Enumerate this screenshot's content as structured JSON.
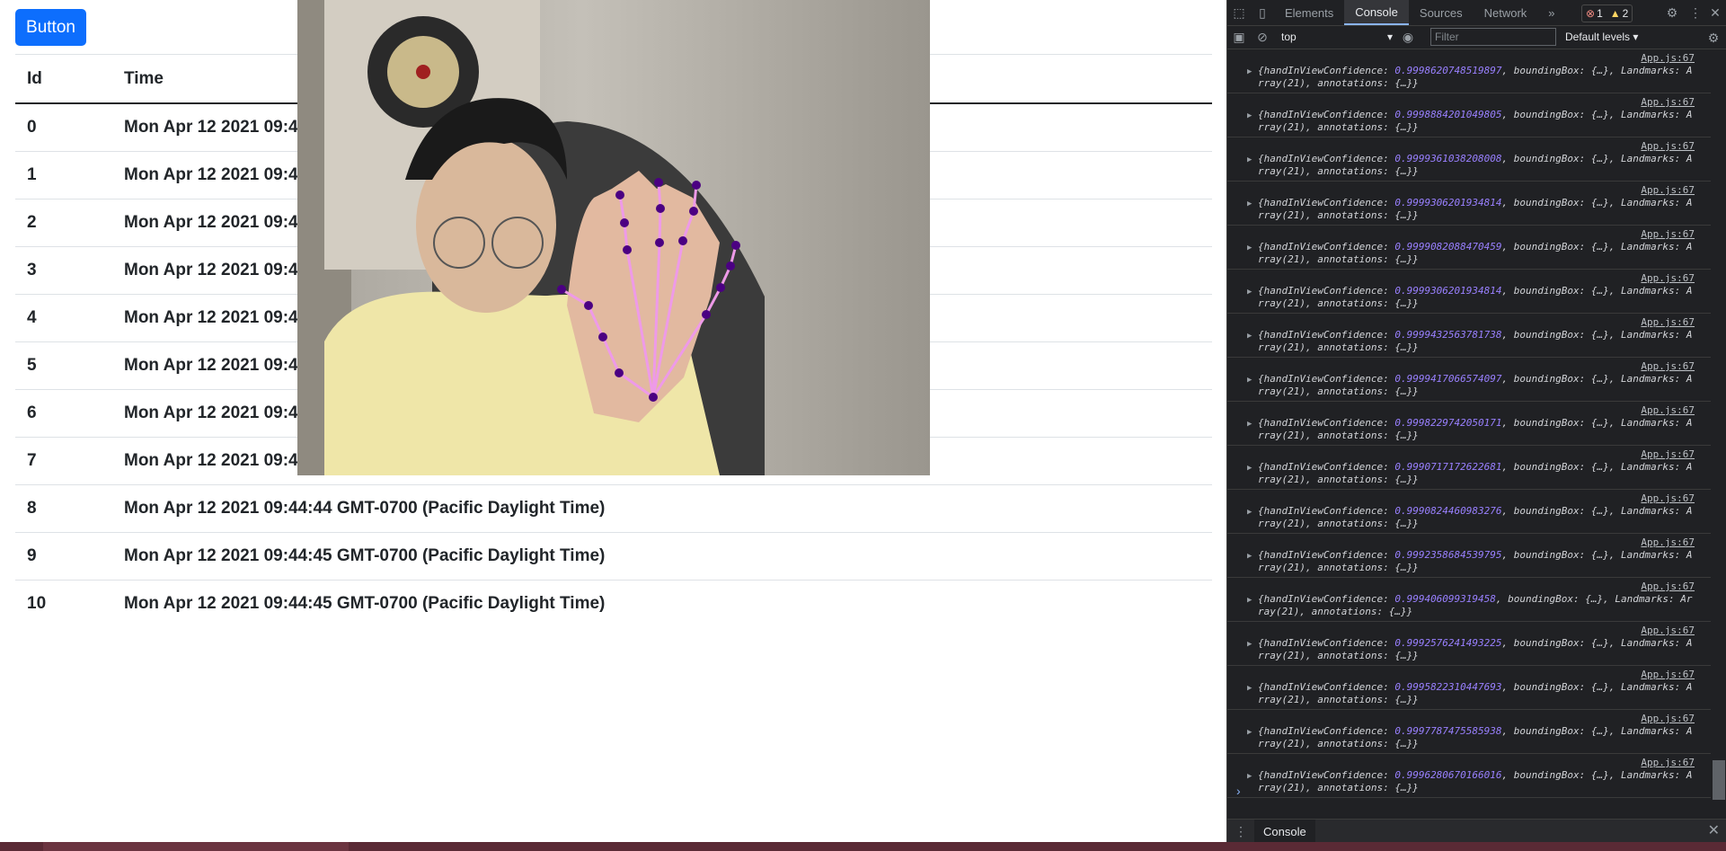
{
  "page": {
    "button_label": "Button",
    "table": {
      "headers": [
        "Id",
        "Time"
      ],
      "rows": [
        {
          "id": "0",
          "time": "Mon Apr 12 2021 09:44"
        },
        {
          "id": "1",
          "time": "Mon Apr 12 2021 09:44"
        },
        {
          "id": "2",
          "time": "Mon Apr 12 2021 09:44"
        },
        {
          "id": "3",
          "time": "Mon Apr 12 2021 09:44"
        },
        {
          "id": "4",
          "time": "Mon Apr 12 2021 09:44"
        },
        {
          "id": "5",
          "time": "Mon Apr 12 2021 09:44"
        },
        {
          "id": "6",
          "time": "Mon Apr 12 2021 09:44"
        },
        {
          "id": "7",
          "time": "Mon Apr 12 2021 09:44"
        },
        {
          "id": "8",
          "time": "Mon Apr 12 2021 09:44:44 GMT-0700 (Pacific Daylight Time)"
        },
        {
          "id": "9",
          "time": "Mon Apr 12 2021 09:44:45 GMT-0700 (Pacific Daylight Time)"
        },
        {
          "id": "10",
          "time": "Mon Apr 12 2021 09:44:45 GMT-0700 (Pacific Daylight Time)"
        }
      ]
    }
  },
  "devtools": {
    "tabs": [
      "Elements",
      "Console",
      "Sources",
      "Network"
    ],
    "active_tab": "Console",
    "more_tabs": "»",
    "error_count": "1",
    "warning_count": "2",
    "context": "top",
    "filter_placeholder": "Filter",
    "levels": "Default levels",
    "drawer_tab": "Console",
    "log_source": "App.js:67",
    "log_entries": [
      {
        "confidence": "0.9998620748519897",
        "l1_tail": ", boundingBox: {…}, Landmarks: A",
        "line2": "rray(21), annotations: {…}}"
      },
      {
        "confidence": "0.9998884201049805",
        "l1_tail": ", boundingBox: {…}, Landmarks: A",
        "line2": "rray(21), annotations: {…}}"
      },
      {
        "confidence": "0.9999361038208008",
        "l1_tail": ", boundingBox: {…}, Landmarks: A",
        "line2": "rray(21), annotations: {…}}"
      },
      {
        "confidence": "0.9999306201934814",
        "l1_tail": ", boundingBox: {…}, Landmarks: A",
        "line2": "rray(21), annotations: {…}}"
      },
      {
        "confidence": "0.9999082088470459",
        "l1_tail": ", boundingBox: {…}, Landmarks: A",
        "line2": "rray(21), annotations: {…}}"
      },
      {
        "confidence": "0.9999306201934814",
        "l1_tail": ", boundingBox: {…}, Landmarks: A",
        "line2": "rray(21), annotations: {…}}"
      },
      {
        "confidence": "0.9999432563781738",
        "l1_tail": ", boundingBox: {…}, Landmarks: A",
        "line2": "rray(21), annotations: {…}}"
      },
      {
        "confidence": "0.9999417066574097",
        "l1_tail": ", boundingBox: {…}, Landmarks: A",
        "line2": "rray(21), annotations: {…}}"
      },
      {
        "confidence": "0.9998229742050171",
        "l1_tail": ", boundingBox: {…}, Landmarks: A",
        "line2": "rray(21), annotations: {…}}"
      },
      {
        "confidence": "0.9990717172622681",
        "l1_tail": ", boundingBox: {…}, Landmarks: A",
        "line2": "rray(21), annotations: {…}}"
      },
      {
        "confidence": "0.9990824460983276",
        "l1_tail": ", boundingBox: {…}, Landmarks: A",
        "line2": "rray(21), annotations: {…}}"
      },
      {
        "confidence": "0.9992358684539795",
        "l1_tail": ", boundingBox: {…}, Landmarks: A",
        "line2": "rray(21), annotations: {…}}"
      },
      {
        "confidence": "0.999406099319458",
        "l1_tail": ", boundingBox: {…}, Landmarks: Ar",
        "line2": "ray(21), annotations: {…}}"
      },
      {
        "confidence": "0.9992576241493225",
        "l1_tail": ", boundingBox: {…}, Landmarks: A",
        "line2": "rray(21), annotations: {…}}"
      },
      {
        "confidence": "0.9995822310447693",
        "l1_tail": ", boundingBox: {…}, Landmarks: A",
        "line2": "rray(21), annotations: {…}}"
      },
      {
        "confidence": "0.9997787475585938",
        "l1_tail": ", boundingBox: {…}, Landmarks: A",
        "line2": "rray(21), annotations: {…}}"
      },
      {
        "confidence": "0.9996280670166016",
        "l1_tail": ", boundingBox: {…}, Landmarks: A",
        "line2": "rray(21), annotations: {…}}"
      }
    ]
  },
  "colors": {
    "primary_button": "#0d6efd",
    "devtools_bg": "#202124",
    "confidence_value": "#9980ff",
    "landmark_point": "#4b0082",
    "landmark_line": "#ee9ae8"
  }
}
